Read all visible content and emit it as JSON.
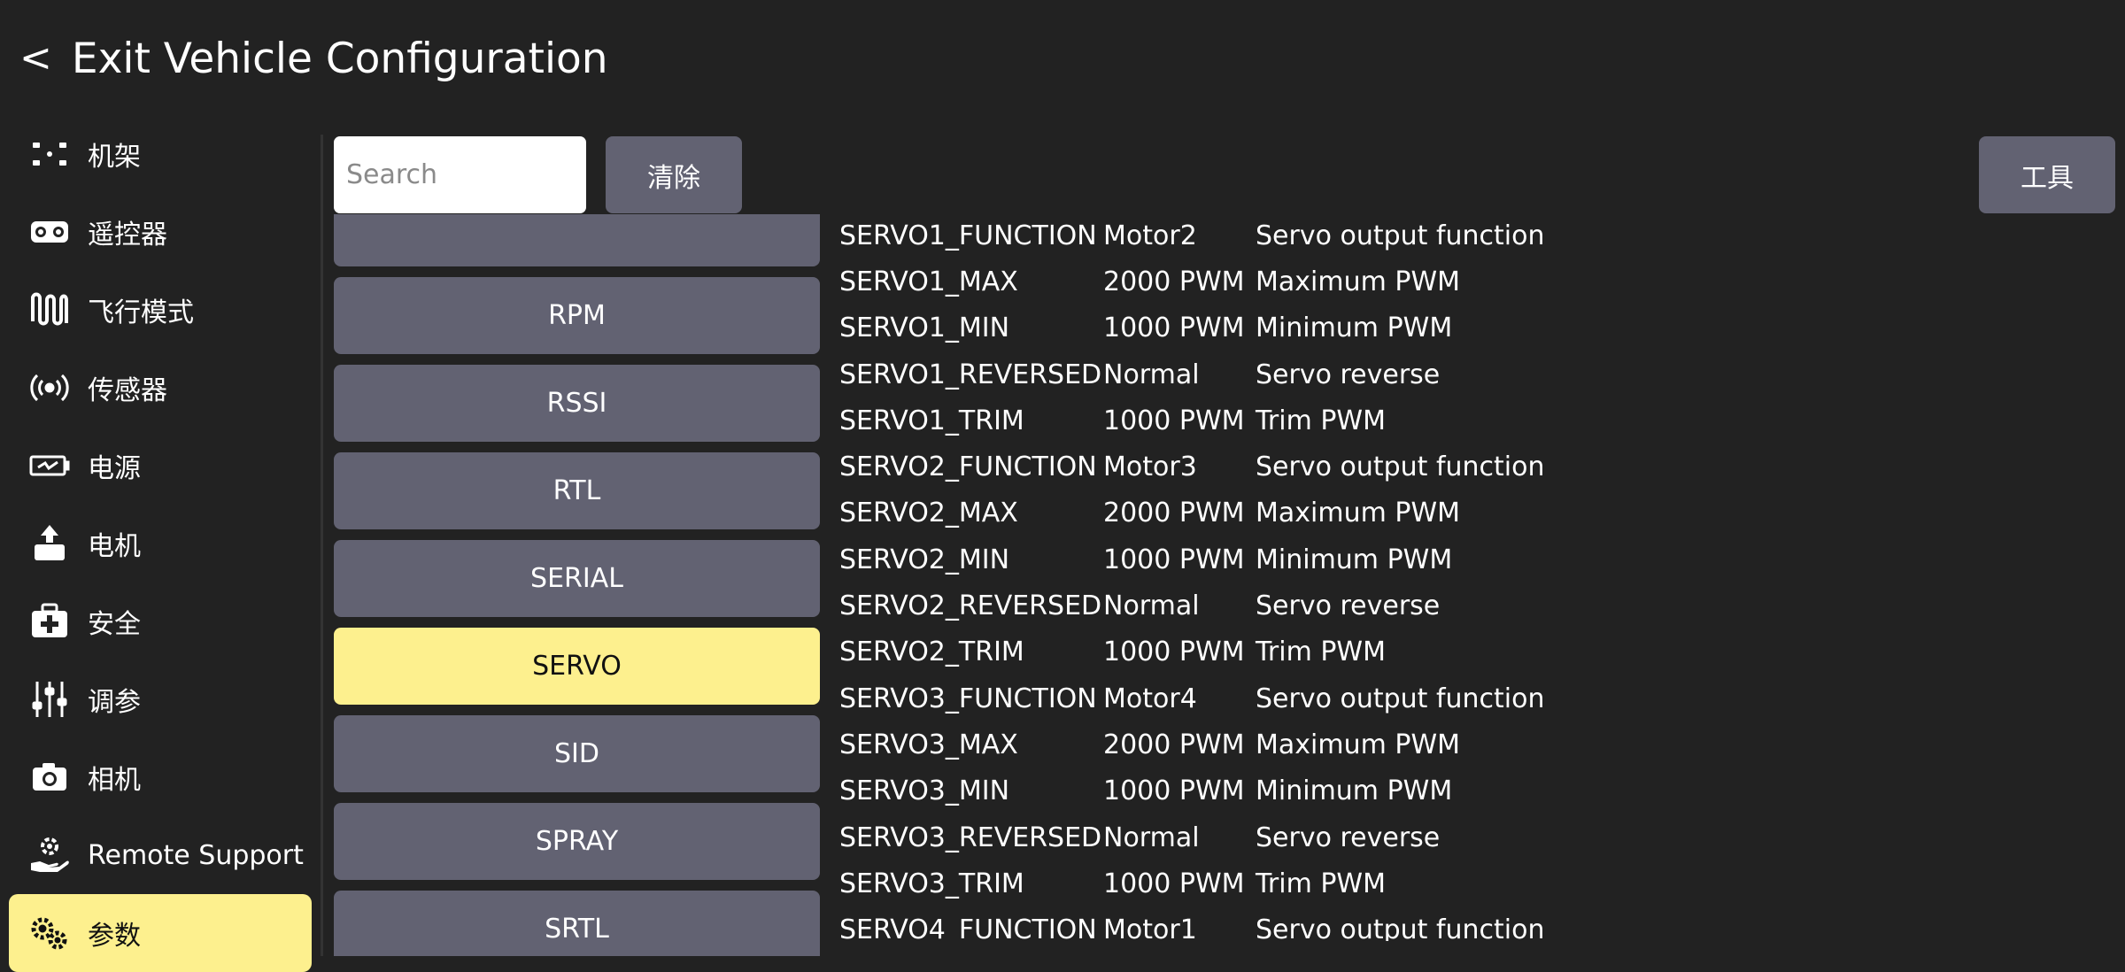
{
  "header": {
    "back_icon": "<",
    "title": "Exit Vehicle Configuration"
  },
  "sidebar": {
    "items": [
      {
        "label": "机架",
        "icon": "airframe-icon"
      },
      {
        "label": "遥控器",
        "icon": "radio-icon"
      },
      {
        "label": "飞行模式",
        "icon": "flight-modes-icon"
      },
      {
        "label": "传感器",
        "icon": "sensors-icon"
      },
      {
        "label": "电源",
        "icon": "power-icon"
      },
      {
        "label": "电机",
        "icon": "motors-icon"
      },
      {
        "label": "安全",
        "icon": "safety-icon"
      },
      {
        "label": "调参",
        "icon": "tuning-icon"
      },
      {
        "label": "相机",
        "icon": "camera-icon"
      },
      {
        "label": "Remote Support",
        "icon": "remote-support-icon"
      },
      {
        "label": "参数",
        "icon": "parameters-icon",
        "active": true
      }
    ]
  },
  "toolbar": {
    "search_placeholder": "Search",
    "search_value": "",
    "clear_label": "清除",
    "tools_label": "工具"
  },
  "groups": {
    "items": [
      {
        "label": ""
      },
      {
        "label": "RPM"
      },
      {
        "label": "RSSI"
      },
      {
        "label": "RTL"
      },
      {
        "label": "SERIAL"
      },
      {
        "label": "SERVO",
        "active": true
      },
      {
        "label": "SID"
      },
      {
        "label": "SPRAY"
      },
      {
        "label": "SRTL"
      }
    ]
  },
  "params": {
    "rows": [
      {
        "name": "SERVO1_FUNCTION",
        "value": "Motor2",
        "desc": "Servo output function"
      },
      {
        "name": "SERVO1_MAX",
        "value": "2000 PWM",
        "desc": "Maximum PWM"
      },
      {
        "name": "SERVO1_MIN",
        "value": "1000 PWM",
        "desc": "Minimum PWM"
      },
      {
        "name": "SERVO1_REVERSED",
        "value": "Normal",
        "desc": "Servo reverse"
      },
      {
        "name": "SERVO1_TRIM",
        "value": "1000 PWM",
        "desc": "Trim PWM"
      },
      {
        "name": "SERVO2_FUNCTION",
        "value": "Motor3",
        "desc": "Servo output function"
      },
      {
        "name": "SERVO2_MAX",
        "value": "2000 PWM",
        "desc": "Maximum PWM"
      },
      {
        "name": "SERVO2_MIN",
        "value": "1000 PWM",
        "desc": "Minimum PWM"
      },
      {
        "name": "SERVO2_REVERSED",
        "value": "Normal",
        "desc": "Servo reverse"
      },
      {
        "name": "SERVO2_TRIM",
        "value": "1000 PWM",
        "desc": "Trim PWM"
      },
      {
        "name": "SERVO3_FUNCTION",
        "value": "Motor4",
        "desc": "Servo output function"
      },
      {
        "name": "SERVO3_MAX",
        "value": "2000 PWM",
        "desc": "Maximum PWM"
      },
      {
        "name": "SERVO3_MIN",
        "value": "1000 PWM",
        "desc": "Minimum PWM"
      },
      {
        "name": "SERVO3_REVERSED",
        "value": "Normal",
        "desc": "Servo reverse"
      },
      {
        "name": "SERVO3_TRIM",
        "value": "1000 PWM",
        "desc": "Trim PWM"
      },
      {
        "name": "SERVO4_FUNCTION",
        "value": "Motor1",
        "desc": "Servo output function"
      }
    ]
  },
  "colors": {
    "background": "#222222",
    "button": "#626272",
    "active": "#fdf08e",
    "text": "#ffffff"
  }
}
